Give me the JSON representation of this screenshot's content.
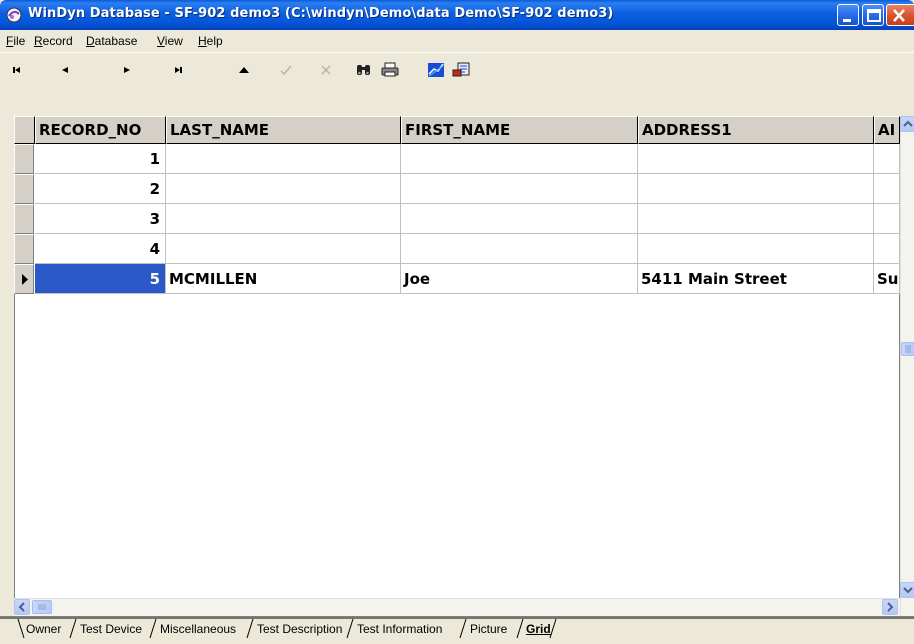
{
  "window": {
    "title": "WinDyn Database - SF-902 demo3  (C:\\windyn\\Demo\\data Demo\\SF-902 demo3)",
    "titlebar_color": "#0454d8",
    "close_color": "#d8522c"
  },
  "menu": {
    "items": [
      "File",
      "Record",
      "Database",
      "View",
      "Help"
    ]
  },
  "toolbar": {
    "buttons": [
      {
        "name": "first-record",
        "icon": "first-record-icon"
      },
      {
        "name": "prev-record",
        "icon": "prev-record-icon"
      },
      {
        "name": "next-record",
        "icon": "next-record-icon"
      },
      {
        "name": "last-record",
        "icon": "last-record-icon"
      },
      {
        "name": "insert-record",
        "icon": "up-triangle-icon"
      },
      {
        "name": "post-edit",
        "icon": "checkmark-icon"
      },
      {
        "name": "cancel-edit",
        "icon": "x-icon"
      },
      {
        "name": "find",
        "icon": "binoculars-icon"
      },
      {
        "name": "print",
        "icon": "printer-icon"
      },
      {
        "name": "chart",
        "icon": "chart-icon"
      },
      {
        "name": "export",
        "icon": "export-icon"
      }
    ]
  },
  "grid": {
    "columns": [
      "RECORD_NO",
      "LAST_NAME",
      "FIRST_NAME",
      "ADDRESS1",
      "AI"
    ],
    "rows": [
      {
        "record_no": "1",
        "last_name": "",
        "first_name": "",
        "address1": "",
        "ai": ""
      },
      {
        "record_no": "2",
        "last_name": "",
        "first_name": "",
        "address1": "",
        "ai": ""
      },
      {
        "record_no": "3",
        "last_name": "",
        "first_name": "",
        "address1": "",
        "ai": ""
      },
      {
        "record_no": "4",
        "last_name": "",
        "first_name": "",
        "address1": "",
        "ai": ""
      },
      {
        "record_no": "5",
        "last_name": "MCMILLEN",
        "first_name": "Joe",
        "address1": "5411 Main Street",
        "ai": "Su"
      }
    ],
    "selected_row": 5,
    "selection_color": "#2b59c8"
  },
  "tabs": {
    "items": [
      "Owner",
      "Test Device",
      "Miscellaneous",
      "Test Description",
      "Test Information",
      "Picture",
      "Grid"
    ],
    "active": "Grid"
  }
}
